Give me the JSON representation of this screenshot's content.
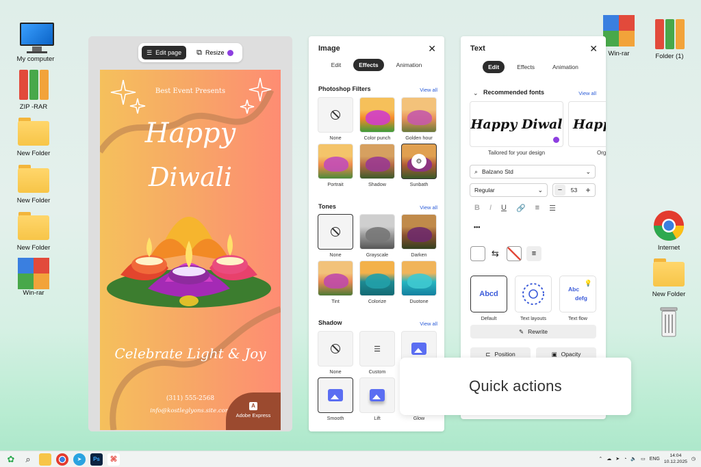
{
  "desktop": {
    "left": [
      {
        "label": "My computer",
        "kind": "pc"
      },
      {
        "label": "ZIP -RAR",
        "kind": "binders"
      },
      {
        "label": "New Folder",
        "kind": "folder"
      },
      {
        "label": "New Folder",
        "kind": "folder"
      },
      {
        "label": "New Folder",
        "kind": "folder"
      },
      {
        "label": "Win-rar",
        "kind": "winrar"
      }
    ],
    "right": [
      {
        "label": "Win-rar",
        "kind": "winrar"
      },
      {
        "label": "Folder (1)",
        "kind": "binders"
      },
      {
        "label": "Internet",
        "kind": "chrome"
      },
      {
        "label": "New Folder",
        "kind": "folder"
      },
      {
        "label": "",
        "kind": "trash"
      }
    ]
  },
  "editor": {
    "edit_page_label": "Edit page",
    "resize_label": "Resize",
    "card": {
      "presents": "Best Event Presents",
      "title_line1": "Happy",
      "title_line2": "Diwali",
      "tagline": "Celebrate Light & Joy",
      "phone": "(311) 555-2568",
      "email": "info@kostleglyons.site.com",
      "brand": "Adobe Express"
    }
  },
  "image_panel": {
    "title": "Image",
    "tabs": [
      "Edit",
      "Effects",
      "Animation"
    ],
    "active_tab": "Effects",
    "view_all": "View all",
    "filters_heading": "Photoshop Filters",
    "filters": [
      "None",
      "Color punch",
      "Golden hour",
      "Portrait",
      "Shadow",
      "Sunbath"
    ],
    "tones_heading": "Tones",
    "tones": [
      "None",
      "Grayscale",
      "Darken",
      "Tint",
      "Colorize",
      "Duotone"
    ],
    "shadow_heading": "Shadow",
    "shadows": [
      "None",
      "Custom",
      "",
      "Smooth",
      "Lift",
      "Glow"
    ]
  },
  "text_panel": {
    "title": "Text",
    "tabs": [
      "Edit",
      "Effects",
      "Animation"
    ],
    "active_tab": "Edit",
    "recommended_heading": "Recommended fonts",
    "view_all": "View all",
    "font_preview_1": "Happy Diwal",
    "font_preview_2": "Happ",
    "font_caption_1": "Tailored for your design",
    "font_caption_2": "Org",
    "font_name": "Balzano Std",
    "font_weight": "Regular",
    "font_size": "53",
    "more": "•••",
    "styles": [
      "Default",
      "Text layouts",
      "Text flow"
    ],
    "style_default_preview": "Abcd",
    "style_flow_preview_1": "Abc",
    "style_flow_preview_2": "defg",
    "rewrite_label": "Rewrite",
    "position_label": "Position",
    "opacity_label": "Opacity"
  },
  "quick_actions_label": "Quick actions",
  "taskbar": {
    "lang": "ENG",
    "time": "14:04",
    "date": "10.12.2025"
  },
  "colors": {
    "card_left": "#f5c05c",
    "card_right": "#fe8c73",
    "accent_blue": "#2a5bd7",
    "dark_tab": "#2c2c2c"
  }
}
